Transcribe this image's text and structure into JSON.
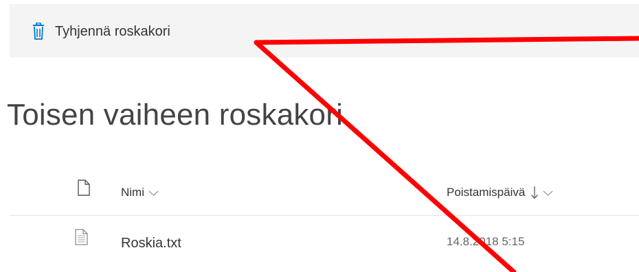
{
  "colors": {
    "accent": "#0078d4",
    "command_bar_bg": "#f4f4f4",
    "annotation": "#ff0000"
  },
  "command_bar": {
    "empty_bin_icon": "trash-can-icon",
    "empty_bin_label": "Tyhjennä roskakori"
  },
  "page": {
    "title": "Toisen vaiheen roskakori"
  },
  "table": {
    "type_icon": "document-icon",
    "columns": [
      {
        "label": "Nimi",
        "icon": "chevron-down-icon"
      },
      {
        "label": "Poistamispäivä",
        "sort": "descending",
        "icons": [
          "sort-down-arrow-icon",
          "chevron-down-icon"
        ]
      }
    ],
    "rows": [
      {
        "icon": "text-file-icon",
        "name": "Roskia.txt",
        "deleted": "14.8.2018 5:15"
      }
    ]
  }
}
